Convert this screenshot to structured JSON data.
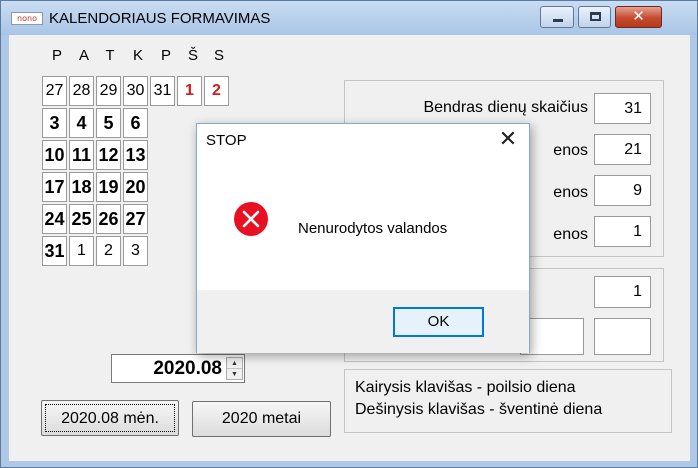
{
  "window": {
    "app_icon_text": "nono",
    "title": "KALENDORIAUS FORMAVIMAS",
    "close_glyph": "✕"
  },
  "calendar": {
    "weekdays": [
      "P",
      "A",
      "T",
      "K",
      "P",
      "Š",
      "S"
    ],
    "rows": [
      [
        "27",
        "28",
        "29",
        "30",
        "31",
        "1",
        "2"
      ],
      [
        "3",
        "4",
        "5",
        "6"
      ],
      [
        "10",
        "11",
        "12",
        "13"
      ],
      [
        "17",
        "18",
        "19",
        "20"
      ],
      [
        "24",
        "25",
        "26",
        "27"
      ],
      [
        "31",
        "1",
        "2",
        "3"
      ]
    ],
    "month_value": "2020.08",
    "spin_up": "▲",
    "spin_down": "▼"
  },
  "buttons": {
    "month": "2020.08 mėn.",
    "year": "2020 metai"
  },
  "stats": {
    "total_label": "Bendras dienų skaičius",
    "total_value": "31",
    "row2_label": "enos",
    "row2_value": "21",
    "row3_label": "enos",
    "row3_value": "9",
    "row4_label": "enos",
    "row4_value": "1",
    "row5_value": "1"
  },
  "hints": {
    "left": "Kairysis klavišas - poilsio diena",
    "right": "Dešinysis klavišas - šventinė diena"
  },
  "dialog": {
    "title": "STOP",
    "close": "✕",
    "message": "Nenurodytos valandos",
    "ok": "OK"
  },
  "colors": {
    "accent": "#0078d7",
    "error": "#e81123",
    "holiday_red": "#d41c1c"
  }
}
